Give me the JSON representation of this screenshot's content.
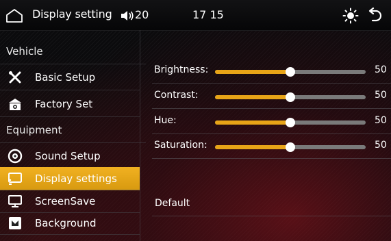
{
  "topbar": {
    "title": "Display setting",
    "volume": "20",
    "clock": "17 15",
    "home_icon": "home-icon",
    "volume_icon": "speaker-icon",
    "brightness_icon": "sun-icon",
    "back_icon": "back-arrow-icon"
  },
  "sidebar": {
    "section_vehicle": "Vehicle",
    "section_equipment": "Equipment",
    "items": [
      {
        "label": "Basic Setup",
        "icon": "tools-icon"
      },
      {
        "label": "Factory Set",
        "icon": "factory-icon"
      },
      {
        "label": "Sound Setup",
        "icon": "speaker-circle-icon"
      },
      {
        "label": "Display settings",
        "icon": "display-icon",
        "active": true
      },
      {
        "label": "ScreenSave",
        "icon": "monitor-icon"
      },
      {
        "label": "Background",
        "icon": "picture-icon"
      }
    ]
  },
  "sliders": [
    {
      "label": "Brightness:",
      "value": "50",
      "fraction": 0.5
    },
    {
      "label": "Contrast:",
      "value": "50",
      "fraction": 0.5
    },
    {
      "label": "Hue:",
      "value": "50",
      "fraction": 0.5
    },
    {
      "label": "Saturation:",
      "value": "50",
      "fraction": 0.5
    }
  ],
  "default_label": "Default",
  "colors": {
    "accent": "#e8a417",
    "track": "#7a7a7a",
    "active_bg": "#f1b121"
  }
}
